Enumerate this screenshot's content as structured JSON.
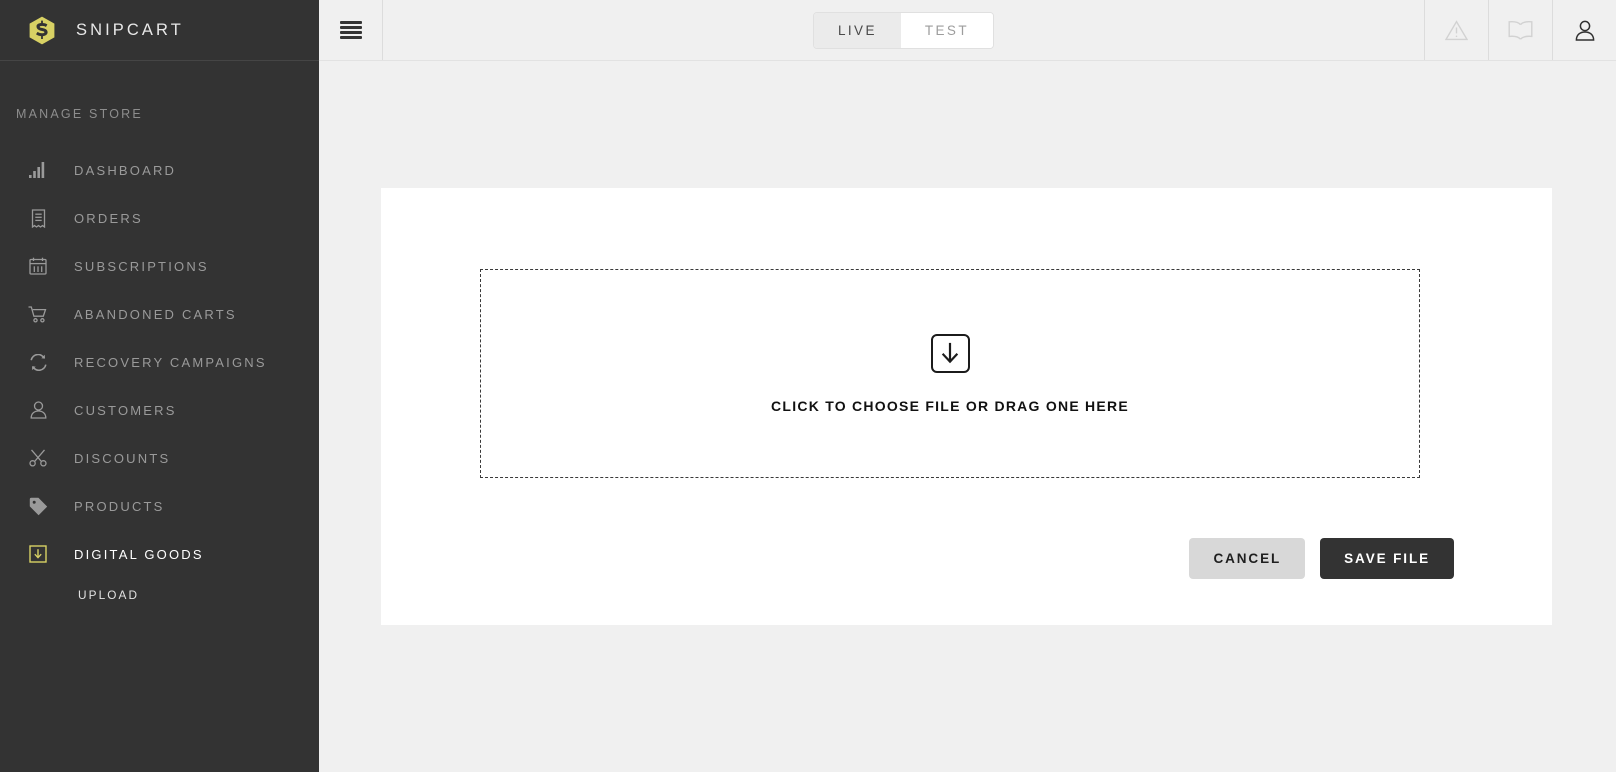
{
  "brand": {
    "name": "SNIPCART",
    "logo_icon": "snipcart-hexagon-logo",
    "logo_color": "#d8d164"
  },
  "sidebar": {
    "section_title": "MANAGE STORE",
    "active_accent_color": "#d8d164",
    "items": [
      {
        "label": "DASHBOARD",
        "icon": "bar-chart-icon",
        "active": false
      },
      {
        "label": "ORDERS",
        "icon": "receipt-icon",
        "active": false
      },
      {
        "label": "SUBSCRIPTIONS",
        "icon": "calendar-icon",
        "active": false
      },
      {
        "label": "ABANDONED CARTS",
        "icon": "shopping-cart-icon",
        "active": false
      },
      {
        "label": "RECOVERY CAMPAIGNS",
        "icon": "refresh-cycle-icon",
        "active": false
      },
      {
        "label": "CUSTOMERS",
        "icon": "user-icon",
        "active": false
      },
      {
        "label": "DISCOUNTS",
        "icon": "scissors-icon",
        "active": false
      },
      {
        "label": "PRODUCTS",
        "icon": "tag-icon",
        "active": false
      },
      {
        "label": "DIGITAL GOODS",
        "icon": "download-box-icon",
        "active": true
      }
    ],
    "sub_item": {
      "label": "UPLOAD",
      "parent": "DIGITAL GOODS"
    }
  },
  "topbar": {
    "menu_icon": "hamburger-menu-icon",
    "env_toggle": {
      "options": [
        "LIVE",
        "TEST"
      ],
      "selected": "LIVE"
    },
    "icons": [
      {
        "name": "warning-triangle-icon",
        "state": "muted"
      },
      {
        "name": "book-docs-icon",
        "state": "muted"
      },
      {
        "name": "user-account-icon",
        "state": "active"
      }
    ]
  },
  "main": {
    "dropzone": {
      "icon": "download-arrow-icon",
      "label": "CLICK TO CHOOSE FILE OR DRAG ONE HERE"
    },
    "buttons": {
      "cancel": "CANCEL",
      "save": "SAVE FILE"
    }
  },
  "colors": {
    "sidebar_bg": "#333333",
    "page_bg": "#f0f0f0",
    "card_bg": "#ffffff",
    "accent_yellow": "#d8d164",
    "primary_button_bg": "#333333"
  }
}
